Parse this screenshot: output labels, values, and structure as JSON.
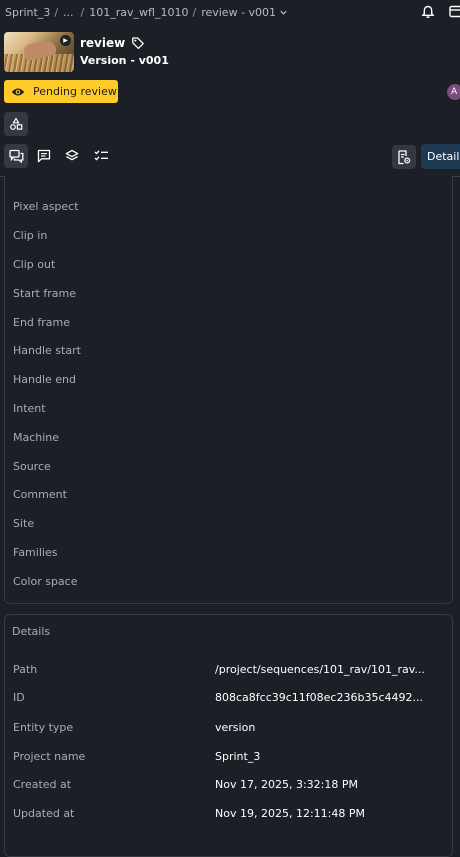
{
  "breadcrumb": {
    "items": [
      "Sprint_3",
      "...",
      "101_rav_wfl_1010",
      "review - v001"
    ],
    "separator": "/"
  },
  "header": {
    "title": "review",
    "subtitle": "Version -  v001",
    "status_label": "Pending review",
    "avatar_initial": "A"
  },
  "tabs": {
    "details_label": "Details"
  },
  "attributes": {
    "rows": [
      "Pixel aspect",
      "Clip in",
      "Clip out",
      "Start frame",
      "End frame",
      "Handle start",
      "Handle end",
      "Intent",
      "Machine",
      "Source",
      "Comment",
      "Site",
      "Families",
      "Color space"
    ]
  },
  "details": {
    "heading": "Details",
    "rows": [
      {
        "label": "Path",
        "value": "/project/sequences/101_rav/101_rav..."
      },
      {
        "label": "ID",
        "value": "808ca8fcc39c11f08ec236b35c4492..."
      },
      {
        "label": "Entity type",
        "value": "version"
      },
      {
        "label": "Project name",
        "value": "Sprint_3"
      },
      {
        "label": "Created at",
        "value": "Nov 17, 2025, 3:32:18 PM"
      },
      {
        "label": "Updated at",
        "value": "Nov 19, 2025, 12:11:48 PM"
      }
    ]
  },
  "colors": {
    "background": "#1c1f25",
    "status_yellow": "#ffcb2b",
    "details_tab": "#1e3a52",
    "avatar": "#7b4c7c"
  },
  "icons": [
    "bell-icon",
    "panel-icon",
    "tag-icon",
    "eye-icon",
    "shapes-icon",
    "comments-icon",
    "chat-icon",
    "layers-icon",
    "checklist-icon",
    "file-settings-icon",
    "play-icon"
  ]
}
